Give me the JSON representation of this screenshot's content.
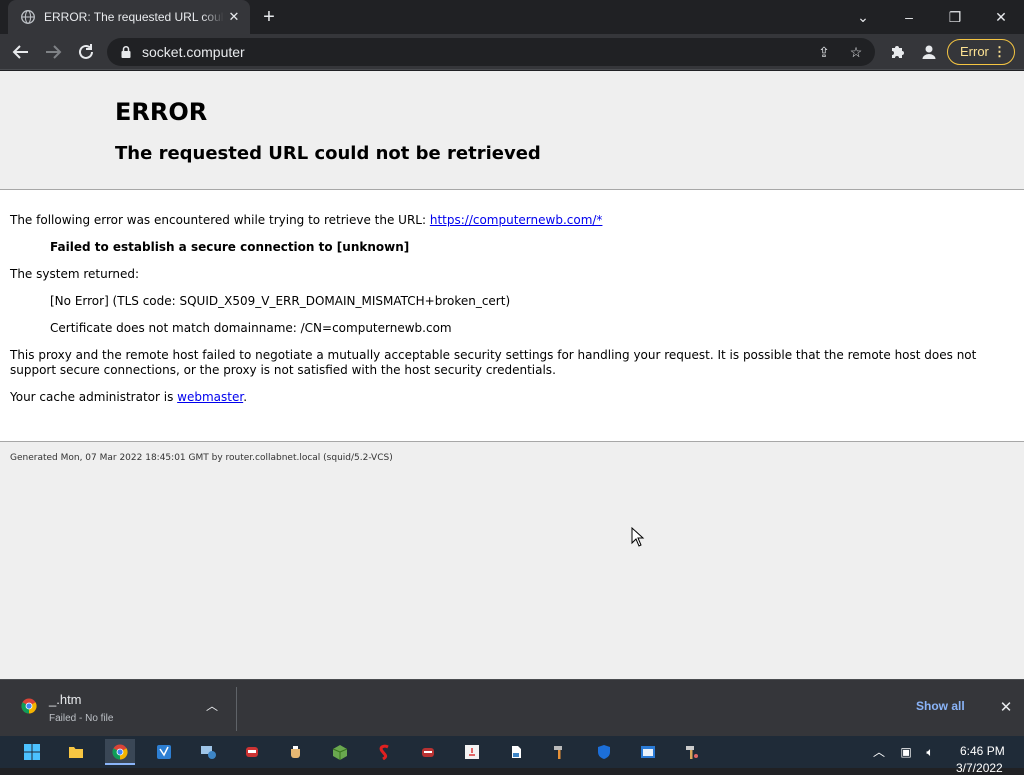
{
  "browser": {
    "tab_title": "ERROR: The requested URL could not be retrieved",
    "new_tab_symbol": "+",
    "url": "socket.computer",
    "error_chip_label": "Error"
  },
  "page": {
    "title": "ERROR",
    "subtitle": "The requested URL could not be retrieved",
    "intro_text": "The following error was encountered while trying to retrieve the URL: ",
    "intro_link": "https://computernewb.com/*",
    "error_heading": "Failed to establish a secure connection to [unknown]",
    "system_returned": "The system returned:",
    "tls_code": "[No Error] (TLS code: SQUID_X509_V_ERR_DOMAIN_MISMATCH+broken_cert)",
    "cert_mismatch": "Certificate does not match domainname: /CN=computernewb.com",
    "explanation": "This proxy and the remote host failed to negotiate a mutually acceptable security settings for handling your request. It is possible that the remote host does not support secure connections, or the proxy is not satisfied with the host security credentials.",
    "admin_prefix": "Your cache administrator is ",
    "admin_link": "webmaster",
    "admin_suffix": ".",
    "footer": "Generated Mon, 07 Mar 2022 18:45:01 GMT by router.collabnet.local (squid/5.2-VCS)"
  },
  "downloads": {
    "file_name": "_.htm",
    "status": "Failed - No file",
    "show_all": "Show all"
  },
  "taskbar": {
    "time": "6:46 PM",
    "date": "3/7/2022"
  },
  "colors": {
    "chrome_dark": "#202124",
    "toolbar": "#35363a",
    "error_chip": "#f5c542",
    "link_blue": "#8ab4f8",
    "page_header_bg": "#efefef",
    "taskbar": "#1f2b38"
  }
}
